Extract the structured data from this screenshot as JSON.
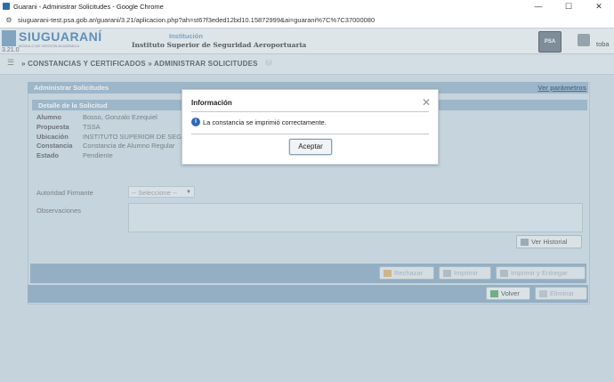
{
  "window": {
    "title": "Guarani - Administrar Solicitudes - Google Chrome",
    "url": "siuguarani-test.psa.gob.ar/guarani/3.21/aplicacion.php?ah=st67f3eded12bd10.15872999&ai=guarani%7C%7C37000080",
    "controls": {
      "minimize": "—",
      "maximize": "☐",
      "close": "✕"
    }
  },
  "header": {
    "logo_text": "SIUGUARANÍ",
    "logo_subtitle": "MÓDULO DE GESTIÓN ACADÉMICA",
    "version": "3.21.0",
    "institution_label": "Institución",
    "institution_name": "Instituto Superior de Seguridad Aeroportuaria",
    "badge": "PSA",
    "user": "toba"
  },
  "breadcrumb": {
    "text": "» CONSTANCIAS Y CERTIFICADOS » ADMINISTRAR SOLICITUDES",
    "help": "?"
  },
  "panel": {
    "title": "Administrar Solicitudes",
    "params_link": "Ver parámetros",
    "detail_title": "Detalle de la Solicitud",
    "fields": [
      {
        "label": "Alumno",
        "value": "Bosso, Gonzalo Ezequiel"
      },
      {
        "label": "Propuesta",
        "value": "TSSA"
      },
      {
        "label": "Ubicación",
        "value": "INSTITUTO SUPERIOR DE SEGUR"
      },
      {
        "label": "Constancia",
        "value": "Constancia de Alumno Regular"
      },
      {
        "label": "Estado",
        "value": "Pendiente"
      }
    ],
    "autoridad_label": "Autoridad Firmante",
    "autoridad_select": "-- Seleccione --",
    "observaciones_label": "Observaciones",
    "ver_historial": "Ver Historial",
    "rechazar": "Rechazar",
    "imprimir": "Imprimir",
    "imprimir_entregar": "Imprimir y Entregar",
    "volver": "Volver",
    "eliminar": "Eliminar"
  },
  "modal": {
    "title": "Información",
    "message": "La constancia se imprimió correctamente.",
    "ok": "Aceptar"
  }
}
